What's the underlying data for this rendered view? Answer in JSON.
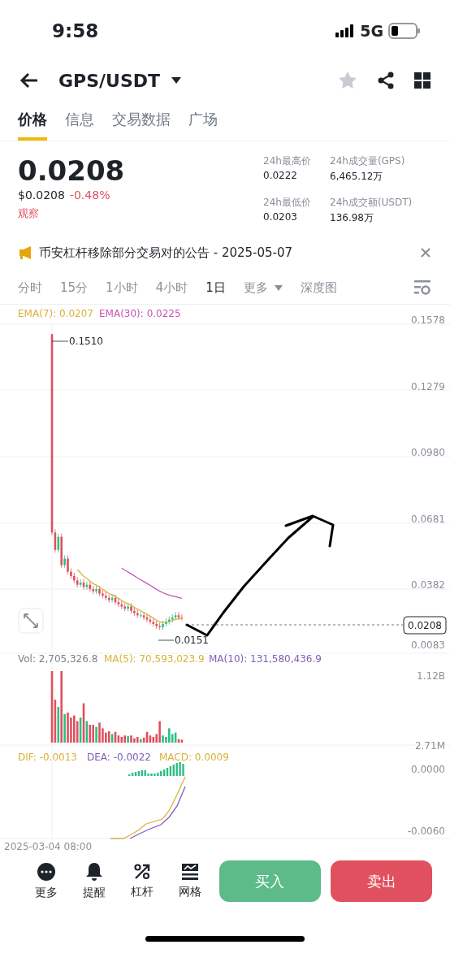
{
  "status_bar": {
    "time": "9:58",
    "network": "5G"
  },
  "header": {
    "pair": "GPS/USDT",
    "favorite": false
  },
  "tabs": [
    {
      "label": "价格",
      "selected": true
    },
    {
      "label": "信息",
      "selected": false
    },
    {
      "label": "交易数据",
      "selected": false
    },
    {
      "label": "广场",
      "selected": false
    }
  ],
  "ticker": {
    "price": "0.0208",
    "usd_price": "$0.0208",
    "change": "-0.48%",
    "tag": "观察"
  },
  "stats": [
    {
      "label": "24h最高价",
      "value": "0.0222"
    },
    {
      "label": "24h成交量(GPS)",
      "value": "6,465.12万"
    },
    {
      "label": "24h最低价",
      "value": "0.0203"
    },
    {
      "label": "24h成交额(USDT)",
      "value": "136.98万"
    }
  ],
  "announcement": {
    "text": "币安杠杆移除部分交易对的公告 - 2025-05-07"
  },
  "intervals": [
    {
      "label": "分时",
      "kind": "interval",
      "selected": false
    },
    {
      "label": "15分",
      "kind": "interval",
      "selected": false
    },
    {
      "label": "1小时",
      "kind": "interval",
      "selected": false
    },
    {
      "label": "4小时",
      "kind": "interval",
      "selected": false
    },
    {
      "label": "1日",
      "kind": "interval",
      "selected": true
    },
    {
      "label": "更多",
      "kind": "menu",
      "selected": false
    },
    {
      "label": "深度图",
      "kind": "interval",
      "selected": false
    }
  ],
  "chart": {
    "ema_legend": [
      {
        "label": "EMA(7): 0.0207",
        "color": "#d9b13a"
      },
      {
        "label": "EMA(30): 0.0225",
        "color": "#c653b4"
      }
    ],
    "price_axis": [
      "0.1578",
      "0.1279",
      "0.0980",
      "0.0681",
      "0.0382",
      "0.0083"
    ],
    "high_marker": "0.1510",
    "low_marker": "0.0151",
    "current_price": "0.0208",
    "volume_legend": [
      {
        "label": "Vol: 2,705,326.8",
        "color": "#7a8089"
      },
      {
        "label": "MA(5): 70,593,023.9",
        "color": "#d9b13a"
      },
      {
        "label": "MA(10): 131,580,436.9",
        "color": "#7d5fb5"
      }
    ],
    "volume_axis": [
      "1.12B",
      "2.71M"
    ],
    "macd_legend": [
      {
        "label": "DIF: -0.0013",
        "color": "#d9b13a"
      },
      {
        "label": "DEA: -0.0022",
        "color": "#7d5fb5"
      },
      {
        "label": "MACD: 0.0009",
        "color": "#d9b13a"
      }
    ],
    "macd_axis": [
      "0.0000",
      "-0.0060"
    ],
    "date_label": "2025-03-04 08:00"
  },
  "bottom_nav": [
    {
      "label": "更多",
      "kind": "more"
    },
    {
      "label": "提醒",
      "kind": "alert"
    },
    {
      "label": "杠杆",
      "kind": "margin"
    },
    {
      "label": "网格",
      "kind": "grid"
    }
  ],
  "actions": [
    {
      "label": "买入",
      "kind": "buy"
    },
    {
      "label": "卖出",
      "kind": "sell"
    }
  ]
}
